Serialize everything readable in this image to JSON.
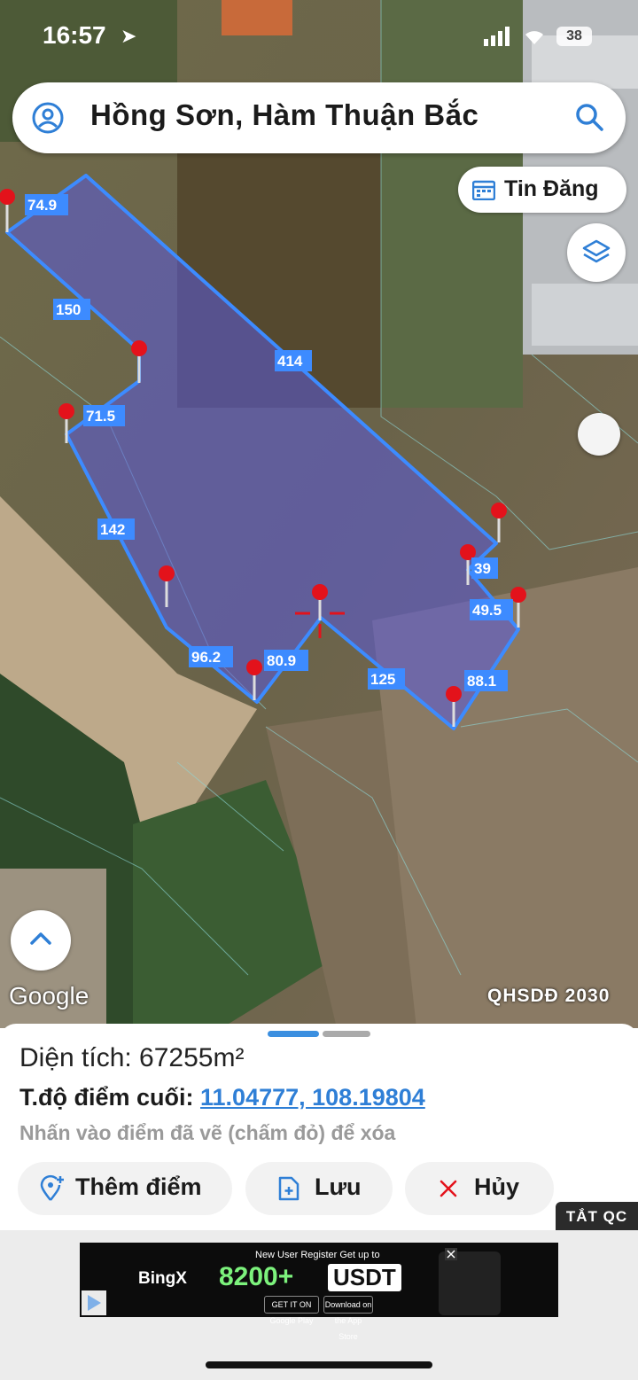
{
  "status_bar": {
    "time": "16:57",
    "battery": "38"
  },
  "search": {
    "title": "Hồng Sơn, Hàm Thuận Bắc"
  },
  "tin_dang": {
    "label": "Tin Đăng"
  },
  "map": {
    "segment_labels": [
      "74.9",
      "150",
      "414",
      "71.5",
      "142",
      "39",
      "49.5",
      "96.2",
      "80.9",
      "125",
      "88.1"
    ],
    "google_label": "Google",
    "layer_label": "QHSDĐ 2030"
  },
  "sheet": {
    "area_text": "Diện tích: 67255m²",
    "coord_label": "T.độ điểm cuối: ",
    "coord_value": "11.04777, 108.19804",
    "hint": "Nhấn vào điểm đã vẽ (chấm đỏ) để xóa",
    "buttons": {
      "add": "Thêm điểm",
      "save": "Lưu",
      "cancel": "Hủy"
    }
  },
  "ad": {
    "close_label": "TẮT QC",
    "brand": "BingX",
    "headline": "New User Register Get up to",
    "amount": "8200+",
    "currency": "USDT",
    "google_play": "GET IT ON Google Play",
    "app_store": "Download on the App Store"
  },
  "colors": {
    "accent": "#2f7fd6",
    "polygon_edge": "#3d8bff",
    "marker": "#e3121b"
  }
}
